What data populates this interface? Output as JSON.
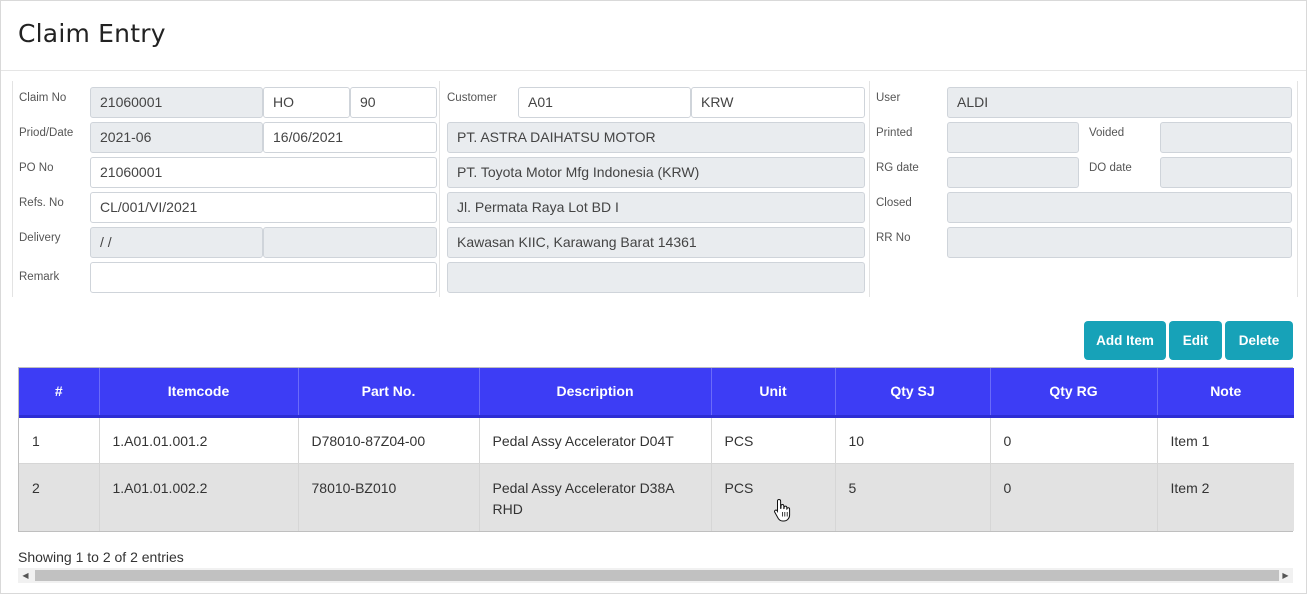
{
  "modal": {
    "title": "Claim Entry"
  },
  "left": {
    "claim_no_label": "Claim No",
    "claim_no": "21060001",
    "claim_branch": "HO",
    "claim_seq": "90",
    "period_label": "Priod/Date",
    "period": "2021-06",
    "date": "16/06/2021",
    "po_label": "PO No",
    "po_no": "21060001",
    "refs_label": "Refs. No",
    "refs_no": "CL/001/VI/2021",
    "delivery_label": "Delivery",
    "delivery": "/ /",
    "delivery2": "",
    "remark_label": "Remark",
    "remark": ""
  },
  "mid": {
    "customer_label": "Customer",
    "customer_code": "A01",
    "customer_area": "KRW",
    "line1": "PT. ASTRA DAIHATSU MOTOR",
    "line2": "PT. Toyota Motor Mfg Indonesia  (KRW)",
    "line3": "Jl. Permata Raya Lot BD I",
    "line4": "Kawasan KIIC, Karawang Barat 14361",
    "line5": ""
  },
  "right": {
    "user_label": "User",
    "user": "ALDI",
    "printed_label": "Printed",
    "printed": "",
    "voided_label": "Voided",
    "voided": "",
    "rg_date_label": "RG date",
    "rg_date": "",
    "do_date_label": "DO date",
    "do_date": "",
    "closed_label": "Closed",
    "closed": "",
    "rr_label": "RR No",
    "rr_no": ""
  },
  "toolbar": {
    "add_label": "Add Item",
    "edit_label": "Edit",
    "delete_label": "Delete"
  },
  "table": {
    "headers": [
      "#",
      "Itemcode",
      "Part No.",
      "Description",
      "Unit",
      "Qty SJ",
      "Qty RG",
      "Note"
    ],
    "rows": [
      [
        "1",
        "1.A01.01.001.2",
        "D78010-87Z04-00",
        "Pedal Assy Accelerator D04T",
        "PCS",
        "10",
        "0",
        "Item 1"
      ],
      [
        "2",
        "1.A01.01.002.2",
        "78010-BZ010",
        "Pedal Assy Accelerator D38A RHD",
        "PCS",
        "5",
        "0",
        "Item 2"
      ]
    ]
  },
  "footer": {
    "info": "Showing 1 to 2 of 2 entries"
  },
  "colors": {
    "header_bg": "#3d3df5",
    "button_bg": "#17a2b8",
    "readonly_bg": "#e9ecef"
  }
}
